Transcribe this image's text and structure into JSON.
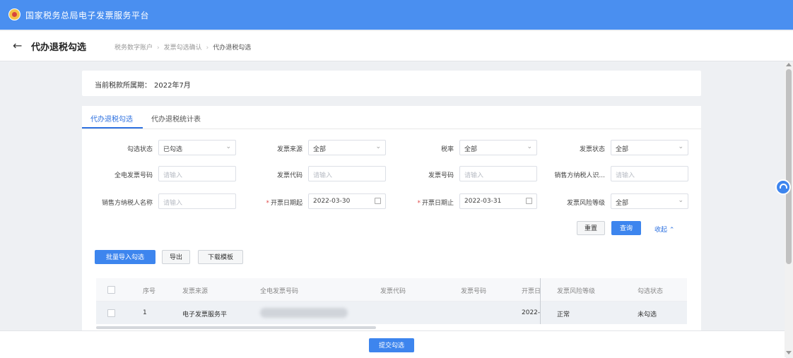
{
  "header": {
    "title": "国家税务总局电子发票服务平台"
  },
  "nav": {
    "page_title": "代办退税勾选",
    "breadcrumb": [
      "税务数字账户",
      "发票勾选确认",
      "代办退税勾选"
    ]
  },
  "period": {
    "label": "当前税款所属期：",
    "value": "2022年7月"
  },
  "tabs": [
    {
      "label": "代办退税勾选",
      "active": true
    },
    {
      "label": "代办退税统计表",
      "active": false
    }
  ],
  "filters": {
    "check_status": {
      "label": "勾选状态",
      "value": "已勾选"
    },
    "invoice_source": {
      "label": "发票来源",
      "value": "全部"
    },
    "tax_rate": {
      "label": "税率",
      "value": "全部"
    },
    "invoice_status": {
      "label": "发票状态",
      "value": "全部"
    },
    "invoice_number_full": {
      "label": "全电发票号码",
      "placeholder": "请输入"
    },
    "invoice_code": {
      "label": "发票代码",
      "placeholder": "请输入"
    },
    "invoice_number": {
      "label": "发票号码",
      "placeholder": "请输入"
    },
    "seller_tax_id": {
      "label": "销售方纳税人识...",
      "placeholder": "请输入"
    },
    "seller_name": {
      "label": "销售方纳税人名称",
      "placeholder": "请输入"
    },
    "date_start": {
      "label": "开票日期起",
      "value": "2022-03-30",
      "required": true
    },
    "date_end": {
      "label": "开票日期止",
      "value": "2022-03-31",
      "required": true
    },
    "risk_level": {
      "label": "发票风险等级",
      "value": "全部"
    }
  },
  "actions": {
    "reset": "重置",
    "query": "查询",
    "collapse": "收起",
    "batch_import": "批量导入勾选",
    "export": "导出",
    "download_template": "下载模板",
    "submit": "提交勾选"
  },
  "table": {
    "columns": [
      "序号",
      "发票来源",
      "全电发票号码",
      "发票代码",
      "发票号码",
      "开票日",
      "发票风险等级",
      "勾选状态"
    ],
    "rows": [
      {
        "index": "1",
        "source": "电子发票服务平",
        "full_number": "",
        "code": "",
        "number": "",
        "date": "2022-",
        "risk": "正常",
        "status": "未勾选"
      }
    ]
  },
  "icons": {
    "logo": "tax-emblem-icon",
    "back": "back-arrow-icon",
    "help": "headset-icon"
  },
  "colors": {
    "header": "#4a8ff0",
    "primary": "#3d85ee",
    "link": "#2f72e0"
  }
}
